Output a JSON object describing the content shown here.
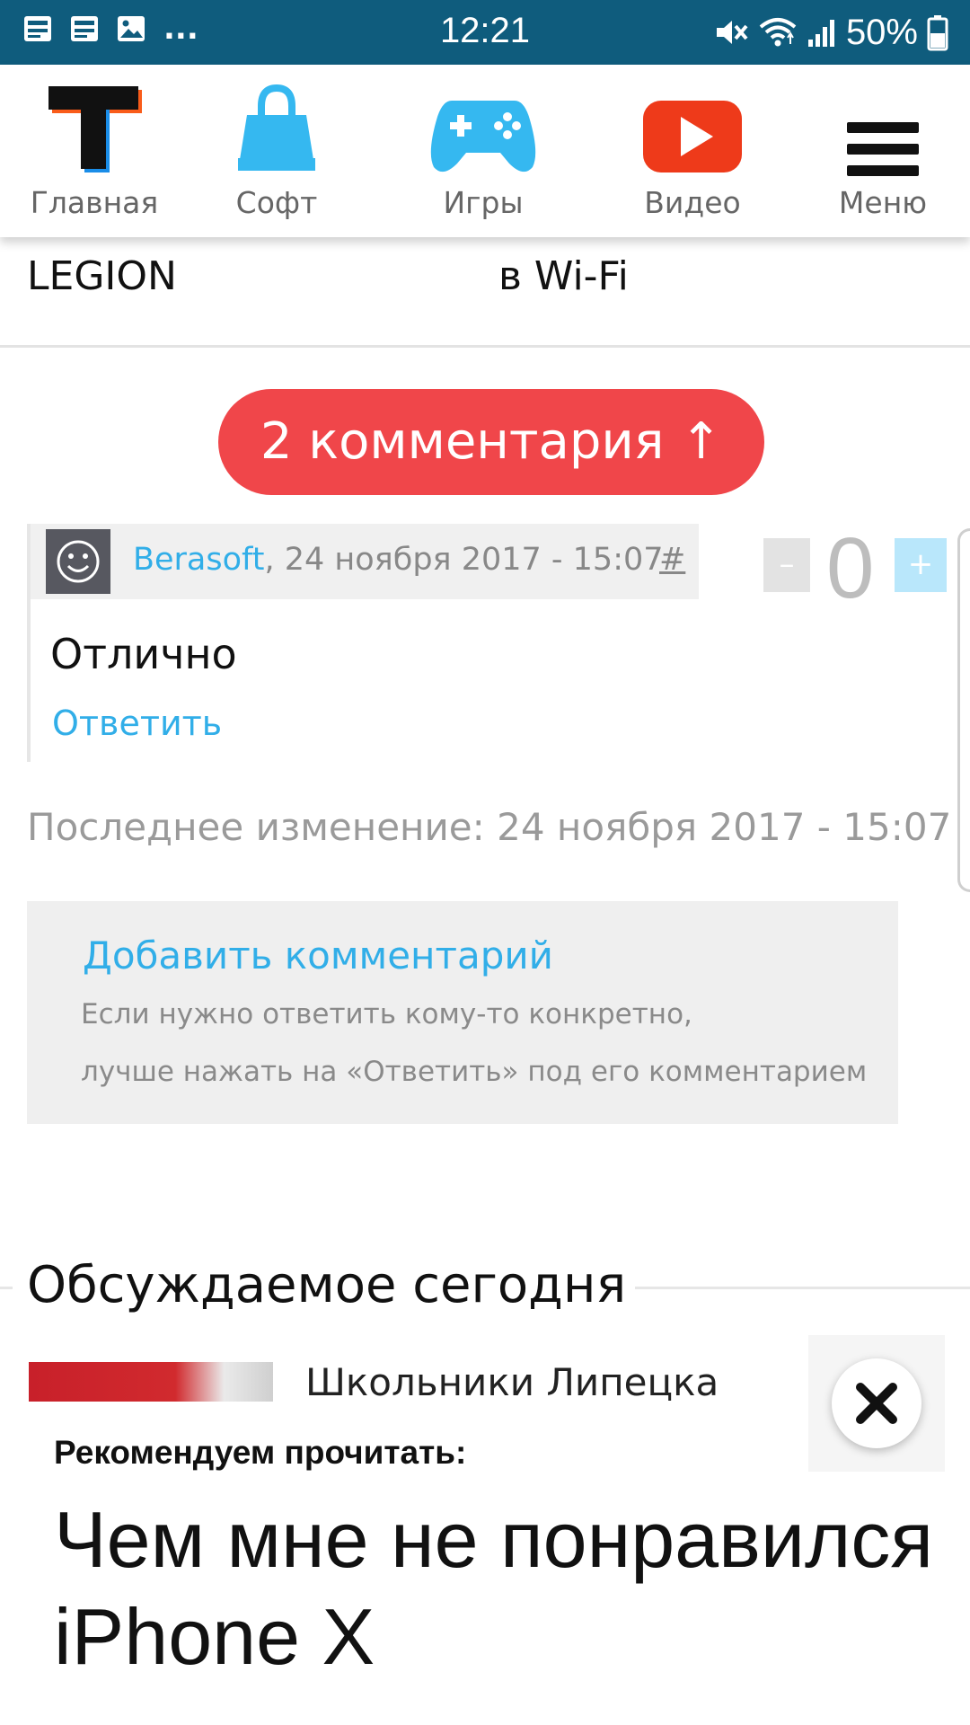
{
  "status_bar": {
    "time": "12:21",
    "battery": "50%",
    "more_indicator": "...",
    "left_icons": [
      "notification-square-icon",
      "notification-square-icon",
      "image-icon"
    ],
    "right_icons": [
      "mute-icon",
      "wifi-icon",
      "signal-icon",
      "battery-icon"
    ]
  },
  "nav": {
    "items": [
      {
        "label": "Главная",
        "icon": "logo-t-icon"
      },
      {
        "label": "Софт",
        "icon": "shopping-bag-icon"
      },
      {
        "label": "Игры",
        "icon": "gamepad-icon"
      },
      {
        "label": "Видео",
        "icon": "play-video-icon"
      },
      {
        "label": "Меню",
        "icon": "hamburger-menu-icon"
      }
    ],
    "colors": {
      "soft": "#35b8f0",
      "games": "#35b8f0",
      "video": "#ee3a1a",
      "logo_orange": "#f95c1a",
      "logo_blue": "#1a8de8"
    }
  },
  "previous_articles": {
    "left": "LEGION",
    "right": "в Wi-Fi"
  },
  "comments_button": {
    "label": "2 комментария ↑"
  },
  "comment": {
    "author": "Berasoft",
    "date": ", 24 ноября 2017 - 15:07",
    "anchor": "#",
    "vote_minus": "–",
    "vote_count": "0",
    "vote_plus": "+",
    "text": "Отлично",
    "reply_label": "Ответить"
  },
  "last_edit": "Последнее изменение: 24 ноября 2017 - 15:07",
  "add_comment": {
    "title": "Добавить комментарий",
    "hint_line1": "Если нужно ответить кому-то конкретно,",
    "hint_line2": "лучше нажать на «Ответить» под его комментарием"
  },
  "discussed": {
    "title": "Обсуждаемое сегодня",
    "first_article_title": "Школьники Липецка"
  },
  "recommendation": {
    "label": "Рекомендуем прочитать:",
    "title": "Чем мне не понравился iPhone X"
  }
}
